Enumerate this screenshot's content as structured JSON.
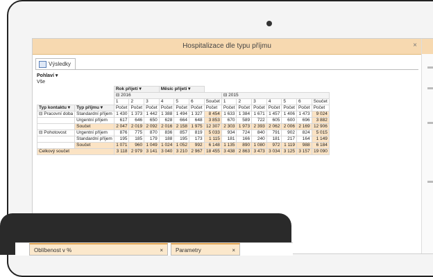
{
  "window": {
    "title": "Hospitalizace dle typu příjmu",
    "close": "×"
  },
  "tab": {
    "label": "Výsledky"
  },
  "filters": {
    "label": "Pohlaví",
    "value": "Vše"
  },
  "pivot": {
    "col_fields": [
      "Rok přijetí",
      "Měsíc přijetí"
    ],
    "row_fields": [
      "Typ kontaktu",
      "Typ příjmu"
    ],
    "years": [
      {
        "label": "2016"
      },
      {
        "label": "2015"
      }
    ],
    "months": [
      "1",
      "2",
      "3",
      "4",
      "5",
      "6",
      "Součet",
      "1",
      "2",
      "3",
      "4",
      "5",
      "6",
      "Součet"
    ],
    "measure": "Počet",
    "groups": [
      {
        "name": "Pracovní doba",
        "rows": [
          {
            "label": "Standardní příjem",
            "values": [
              "1 430",
              "1 373",
              "1 442",
              "1 388",
              "1 494",
              "1 327",
              "8 454",
              "1 633",
              "1 384",
              "1 671",
              "1 457",
              "1 406",
              "1 473",
              "9 024"
            ]
          },
          {
            "label": "Urgentní příjem",
            "values": [
              "617",
              "646",
              "650",
              "628",
              "664",
              "648",
              "3 853",
              "670",
              "589",
              "722",
              "605",
              "600",
              "696",
              "3 882"
            ]
          },
          {
            "label": "Součet",
            "values": [
              "2 047",
              "2 019",
              "2 092",
              "2 016",
              "2 158",
              "1 975",
              "12 307",
              "2 303",
              "1 973",
              "2 393",
              "2 062",
              "2 006",
              "2 169",
              "12 906"
            ]
          }
        ]
      },
      {
        "name": "Pohotovost",
        "rows": [
          {
            "label": "Urgentní příjem",
            "values": [
              "876",
              "775",
              "870",
              "836",
              "857",
              "819",
              "5 033",
              "934",
              "724",
              "840",
              "791",
              "902",
              "824",
              "5 015"
            ]
          },
          {
            "label": "Standardní příjem",
            "values": [
              "195",
              "185",
              "179",
              "188",
              "195",
              "173",
              "1 115",
              "181",
              "166",
              "240",
              "181",
              "217",
              "164",
              "1 149"
            ]
          },
          {
            "label": "Součet",
            "values": [
              "1 071",
              "960",
              "1 049",
              "1 024",
              "1 052",
              "992",
              "6 148",
              "1 135",
              "890",
              "1 080",
              "972",
              "1 119",
              "988",
              "6 184"
            ]
          }
        ]
      }
    ],
    "grand_total": {
      "label": "Celkový součet",
      "values": [
        "3 118",
        "2 979",
        "3 141",
        "3 040",
        "3 210",
        "2 967",
        "18 455",
        "3 438",
        "2 863",
        "3 473",
        "3 034",
        "3 125",
        "3 157",
        "19 090"
      ]
    }
  },
  "lower_tabs": {
    "tab1": "Oblíbenost v %",
    "tab2": "Parametry"
  }
}
